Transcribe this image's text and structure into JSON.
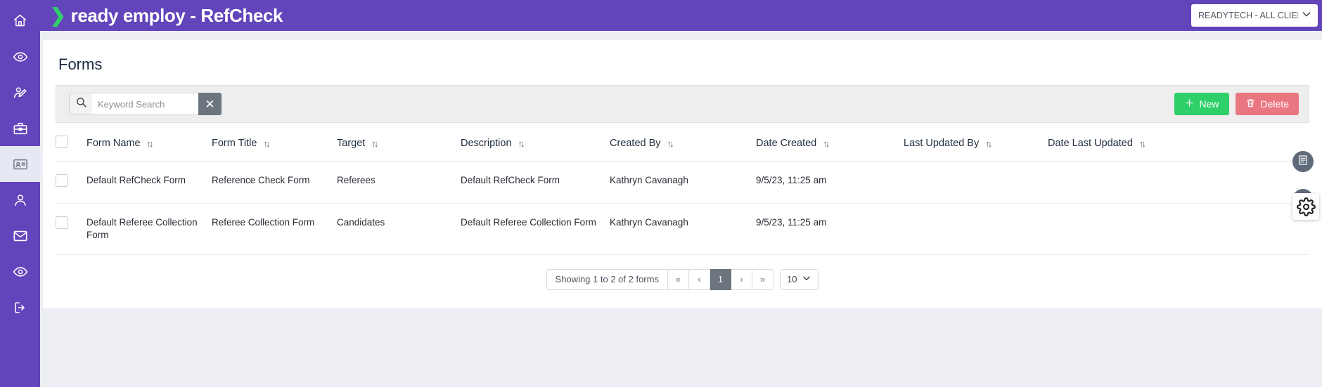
{
  "app": {
    "brand_prefix": "ready employ",
    "brand_suffix": " - RefCheck",
    "brand_full": "ready employ - RefCheck",
    "accent_purple": "#6244bb",
    "accent_green": "#2fd06a",
    "accent_red": "#ea7681"
  },
  "header": {
    "home_icon": "home-icon",
    "client_selector": {
      "value": "READYTECH - ALL CLIENTS",
      "caret_icon": "chevron-down-icon"
    }
  },
  "sidebar": {
    "items": [
      {
        "icon": "home-icon",
        "label": "Home",
        "active": false
      },
      {
        "icon": "eye-icon",
        "label": "Overview",
        "active": false
      },
      {
        "icon": "user-edit-icon",
        "label": "Edit User",
        "active": false
      },
      {
        "icon": "briefcase-icon",
        "label": "Jobs",
        "active": false
      },
      {
        "icon": "id-card-icon",
        "label": "Forms",
        "active": true
      },
      {
        "icon": "user-icon",
        "label": "Profile",
        "active": false
      },
      {
        "icon": "envelope-icon",
        "label": "Messages",
        "active": false
      },
      {
        "icon": "eye-icon",
        "label": "View",
        "active": false
      },
      {
        "icon": "logout-icon",
        "label": "Log Out",
        "active": false
      }
    ]
  },
  "main": {
    "page_title": "Forms",
    "toolbar": {
      "search_icon": "search-icon",
      "search_value": "",
      "search_placeholder": "Keyword Search",
      "clear_label": "✕",
      "new_label": "New",
      "new_icon": "plus-icon",
      "delete_label": "Delete",
      "delete_icon": "trash-icon"
    },
    "table": {
      "sort_icon": "sort-updown-icon",
      "select_all_checkbox": "",
      "columns": [
        {
          "key": "form_name",
          "label": "Form Name",
          "sortable": true
        },
        {
          "key": "form_title",
          "label": "Form Title",
          "sortable": true
        },
        {
          "key": "target",
          "label": "Target",
          "sortable": true
        },
        {
          "key": "description",
          "label": "Description",
          "sortable": true
        },
        {
          "key": "created_by",
          "label": "Created By",
          "sortable": true
        },
        {
          "key": "date_created",
          "label": "Date Created",
          "sortable": true
        },
        {
          "key": "last_updated_by",
          "label": "Last Updated By",
          "sortable": true
        },
        {
          "key": "date_last_updated",
          "label": "Date Last Updated",
          "sortable": true
        }
      ],
      "rows": [
        {
          "form_name": "Default RefCheck Form",
          "form_title": "Reference Check Form",
          "target": "Referees",
          "description": "Default RefCheck Form",
          "created_by": "Kathryn Cavanagh",
          "date_created": "9/5/23, 11:25 am",
          "last_updated_by": "",
          "date_last_updated": "",
          "action_icon": "document-list-icon"
        },
        {
          "form_name": "Default Referee Collection Form",
          "form_title": "Referee Collection Form",
          "target": "Candidates",
          "description": "Default Referee Collection Form",
          "created_by": "Kathryn Cavanagh",
          "date_created": "9/5/23, 11:25 am",
          "last_updated_by": "",
          "date_last_updated": "",
          "action_icon": "document-list-icon"
        }
      ]
    },
    "pagination": {
      "showing_text": "Showing 1 to 2 of 2 forms",
      "first_label": "«",
      "prev_label": "‹",
      "current_page": "1",
      "next_label": "›",
      "last_label": "»",
      "page_size": "10",
      "page_size_caret": "chevron-down-icon"
    }
  },
  "cursor": {
    "icon": "gear-icon"
  }
}
